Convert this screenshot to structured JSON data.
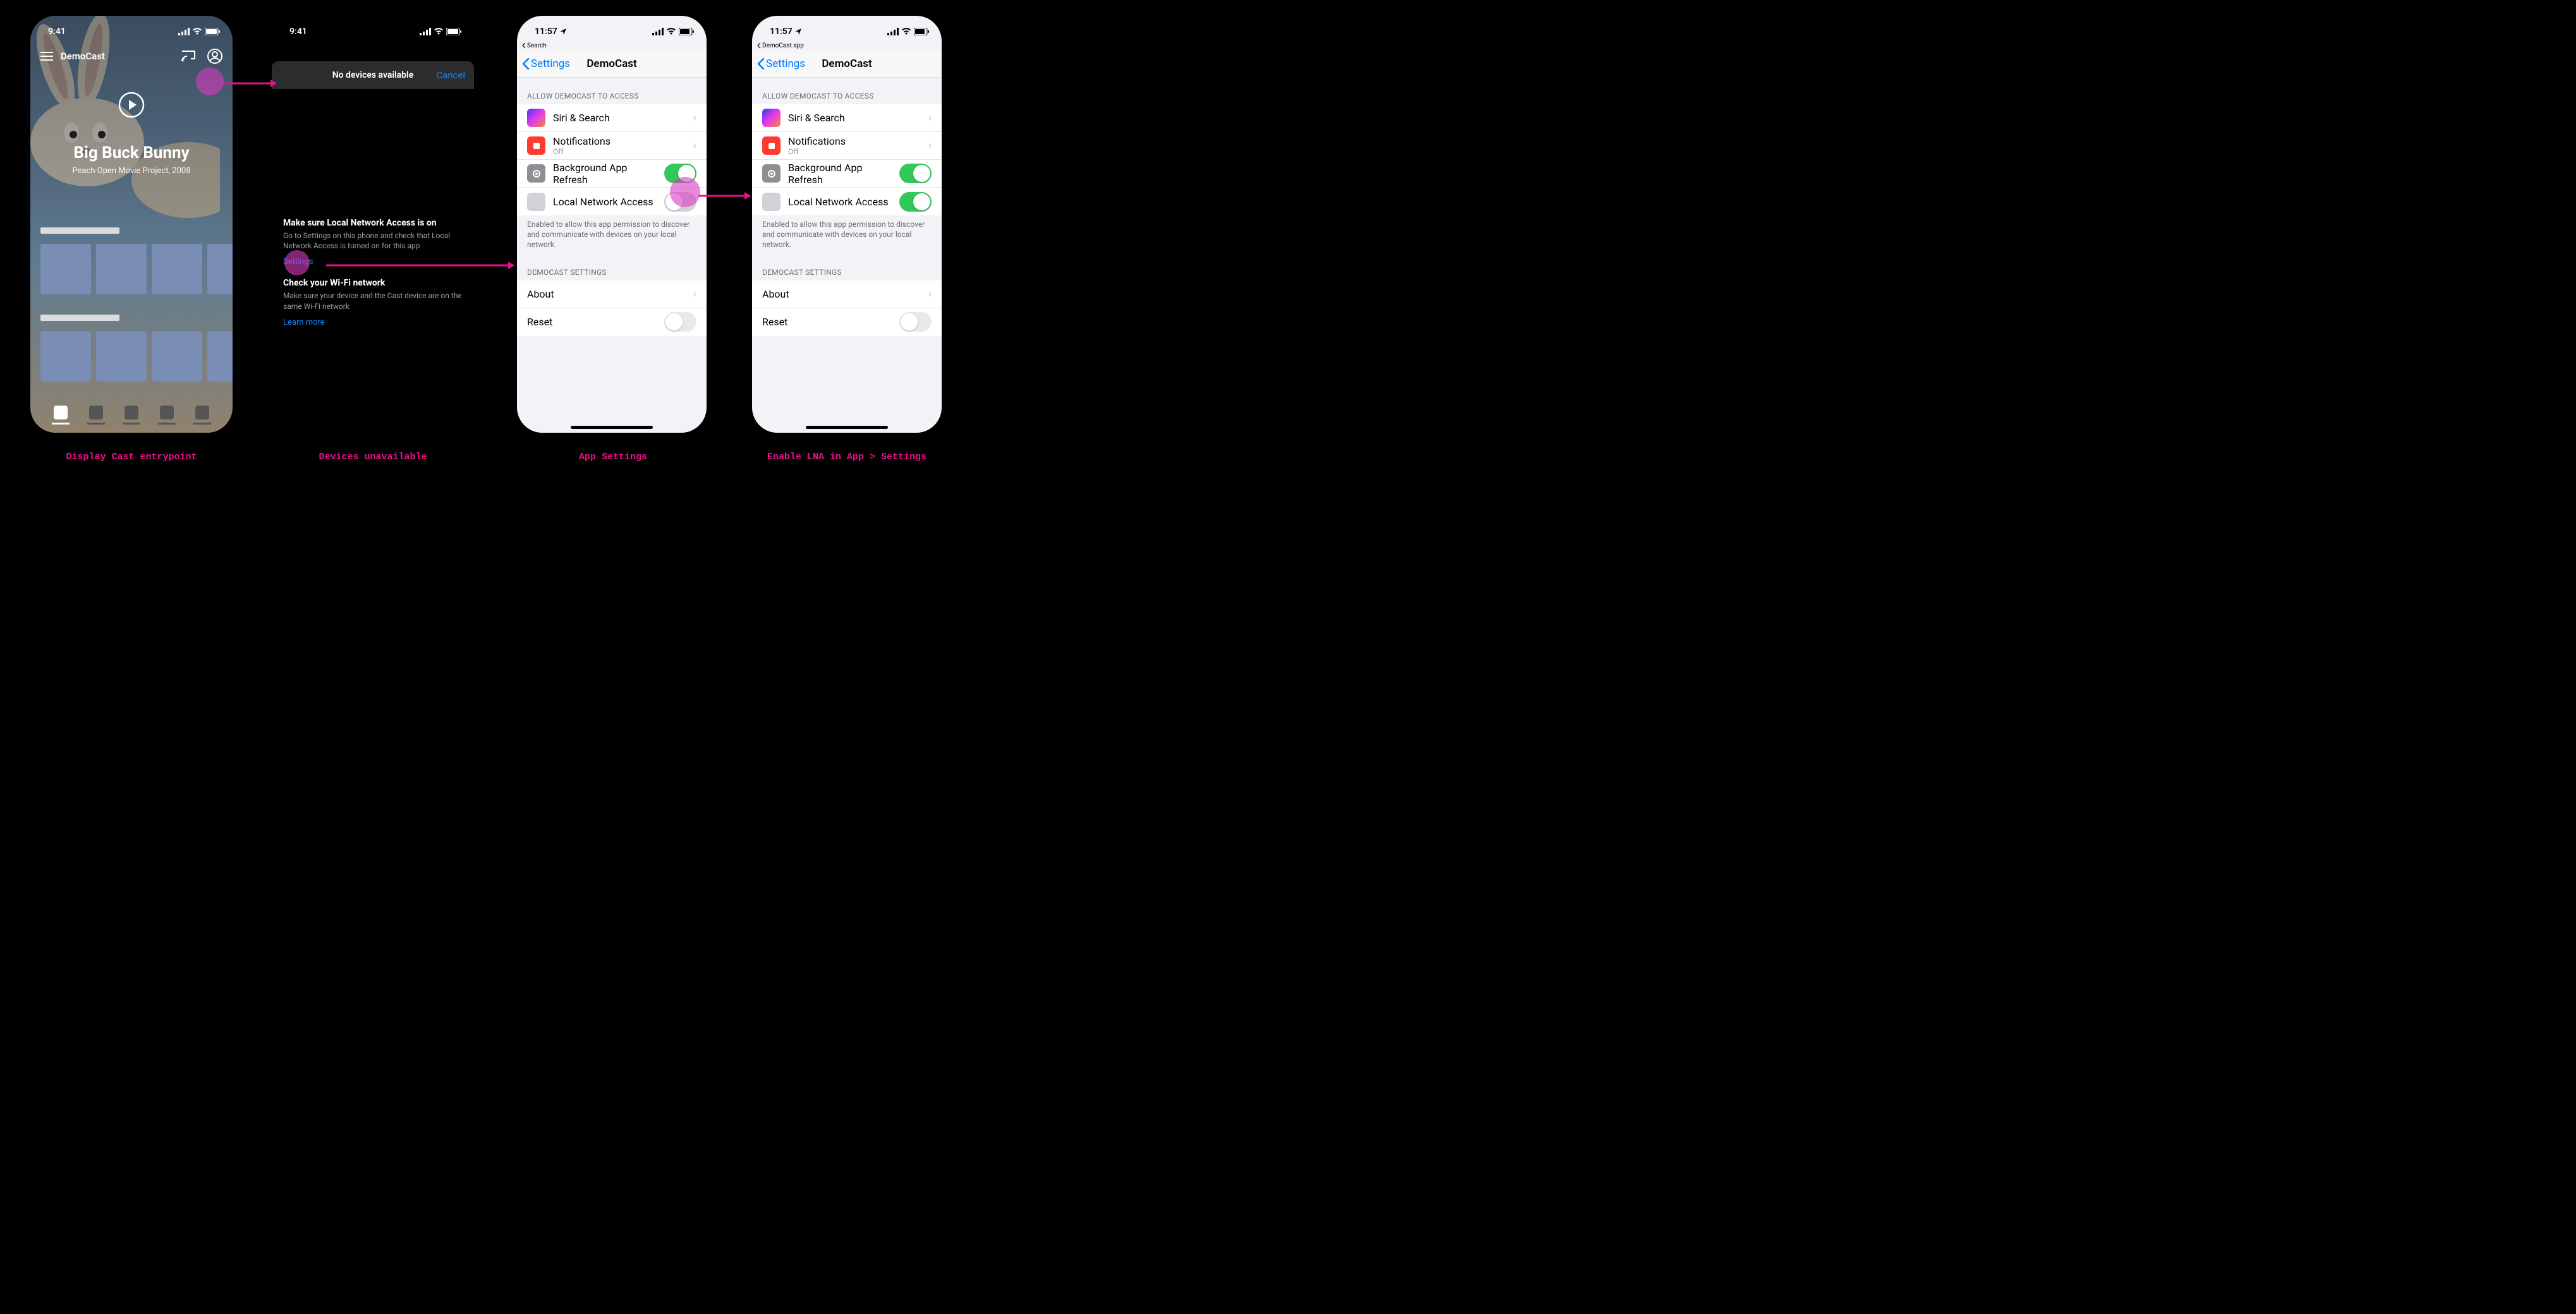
{
  "captions": {
    "c1": "Display Cast entrypoint",
    "c2": "Devices unavailable",
    "c3": "App Settings",
    "c4": "Enable LNA in App > Settings"
  },
  "phone1": {
    "time": "9:41",
    "app_name": "DemoCast",
    "hero_title": "Big Buck Bunny",
    "hero_subtitle": "Peach Open Movie Project, 2008"
  },
  "phone2": {
    "time": "9:41",
    "sheet_title": "No devices available",
    "cancel": "Cancel",
    "s1_h": "Make sure Local Network Access is on",
    "s1_p": "Go to Settings on this phone and check that Local Network Access is turned on for this app",
    "s1_link": "Settings",
    "s2_h": "Check your Wi-Fi network",
    "s2_p": "Make sure your device and the Cast device are on the same Wi-Fi network",
    "s2_link": "Learn more"
  },
  "settings_common": {
    "time": "11:57",
    "back": "Settings",
    "title": "DemoCast",
    "sec_allow": "ALLOW DEMOCAST TO ACCESS",
    "siri": "Siri & Search",
    "notif": "Notifications",
    "notif_sub": "Off",
    "bg_refresh": "Background App Refresh",
    "lna": "Local Network Access",
    "lna_footer": "Enabled to allow this app permission to discover and communicate with devices on your local network.",
    "sec_app": "DEMOCAST SETTINGS",
    "about": "About",
    "reset": "Reset"
  },
  "phone3": {
    "breadcrumb": "Search"
  },
  "phone4": {
    "breadcrumb": "DemoCast app"
  }
}
